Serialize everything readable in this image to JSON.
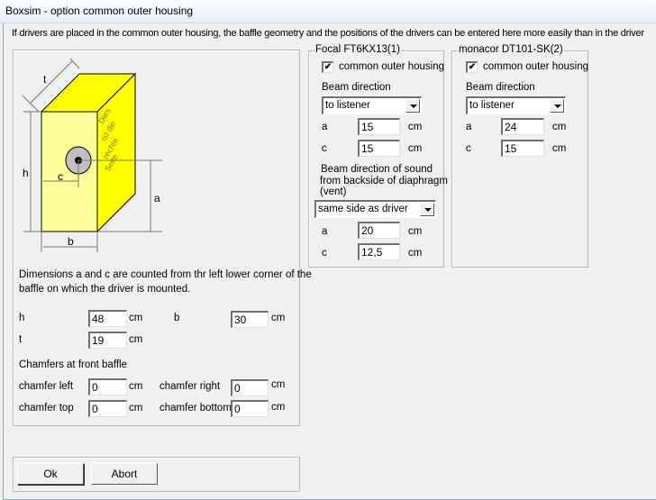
{
  "window": {
    "title": "Boxsim - option common outer housing"
  },
  "intro": "If drivers are placed in the common outer housing,  the baffle geometry and the positions of the drivers can be entered here more easily than in the driver",
  "diagram": {
    "labels": {
      "t": "t",
      "h": "h",
      "c": "c",
      "a": "a",
      "b": "b"
    },
    "side_text": [
      "Dies",
      "ist die",
      "rechte",
      "Seite"
    ],
    "box_color": "#ffff00",
    "front_color": "#ffff99"
  },
  "geometry": {
    "note_line1": "Dimensions a and c are counted from thr left lower corner of the",
    "note_line2": "baffle on which the driver is mounted.",
    "h": {
      "label": "h",
      "value": "48",
      "unit": "cm"
    },
    "b": {
      "label": "b",
      "value": "30",
      "unit": "cm"
    },
    "t": {
      "label": "t",
      "value": "19",
      "unit": "cm"
    },
    "chamfers_title": "Chamfers at front baffle",
    "chamfer_left": {
      "label": "chamfer left",
      "value": "0",
      "unit": "cm"
    },
    "chamfer_right": {
      "label": "chamfer right",
      "value": "0",
      "unit": "cm"
    },
    "chamfer_top": {
      "label": "chamfer top",
      "value": "0",
      "unit": "cm"
    },
    "chamfer_bottom": {
      "label": "chamfer bottom",
      "value": "0",
      "unit": "cm"
    }
  },
  "drivers": [
    {
      "name": "Focal FT6KX13(1)",
      "common_housing_label": "common outer housing",
      "checked": true,
      "beam_label": "Beam direction",
      "beam_value": "to listener",
      "a": {
        "label": "a",
        "value": "15",
        "unit": "cm"
      },
      "c": {
        "label": "c",
        "value": "15",
        "unit": "cm"
      },
      "back_beam_label": [
        "Beam direction of sound",
        "from backside of diaphragm",
        "(vent)"
      ],
      "back_beam_value": "same side as driver",
      "back_a": {
        "label": "a",
        "value": "20",
        "unit": "cm"
      },
      "back_c": {
        "label": "c",
        "value": "12,5",
        "unit": "cm"
      }
    },
    {
      "name": "monacor DT101-SK(2)",
      "common_housing_label": "common outer housing",
      "checked": true,
      "beam_label": "Beam direction",
      "beam_value": "to listener",
      "a": {
        "label": "a",
        "value": "24",
        "unit": "cm"
      },
      "c": {
        "label": "c",
        "value": "15",
        "unit": "cm"
      }
    }
  ],
  "buttons": {
    "ok": "Ok",
    "abort": "Abort"
  },
  "check_glyph": "✔"
}
